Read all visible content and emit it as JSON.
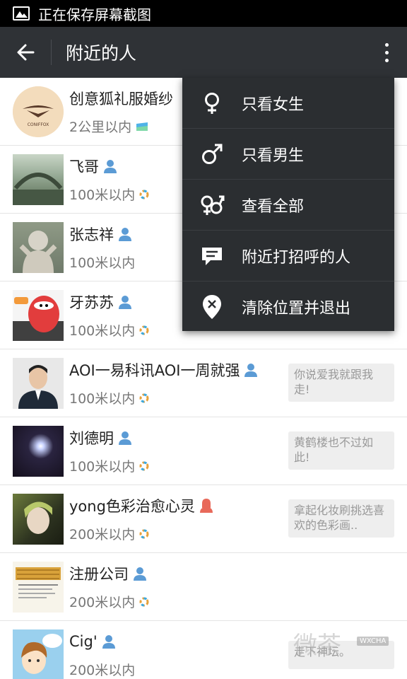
{
  "status_bar": {
    "text": "正在保存屏幕截图"
  },
  "toolbar": {
    "title": "附近的人"
  },
  "list": [
    {
      "name": "创意狐礼服婚纱",
      "distance": "2公里以内",
      "sign": ""
    },
    {
      "name": "飞哥",
      "distance": "100米以内",
      "sign": ""
    },
    {
      "name": "张志祥",
      "distance": "100米以内",
      "sign": ""
    },
    {
      "name": "牙苏苏",
      "distance": "100米以内",
      "sign": ""
    },
    {
      "name": "AOI一易科讯AOI一周就强",
      "distance": "100米以内",
      "sign": "你说爱我就跟我走!"
    },
    {
      "name": "刘德明",
      "distance": "100米以内",
      "sign": "黄鹤楼也不过如此!"
    },
    {
      "name": "yong色彩治愈心灵",
      "distance": "200米以内",
      "sign": "拿起化妆刷挑选喜欢的色彩画.."
    },
    {
      "name": "注册公司",
      "distance": "200米以内",
      "sign": ""
    },
    {
      "name": "Cig'",
      "distance": "200米以内",
      "sign": "走下神坛。"
    }
  ],
  "avatar_logo_text": "CONIFFOX",
  "menu": [
    {
      "label": "只看女生",
      "icon": "female-icon"
    },
    {
      "label": "只看男生",
      "icon": "male-icon"
    },
    {
      "label": "查看全部",
      "icon": "all-gender-icon"
    },
    {
      "label": "附近打招呼的人",
      "icon": "message-icon"
    },
    {
      "label": "清除位置并退出",
      "icon": "location-clear-icon"
    }
  ],
  "watermark": {
    "text": "微茶",
    "badge": "WXCHA"
  },
  "colors": {
    "toolbar": "#2f3236",
    "menu": "#2b2e31",
    "male_blue": "#5b9bd5",
    "female_red": "#e8695a"
  }
}
